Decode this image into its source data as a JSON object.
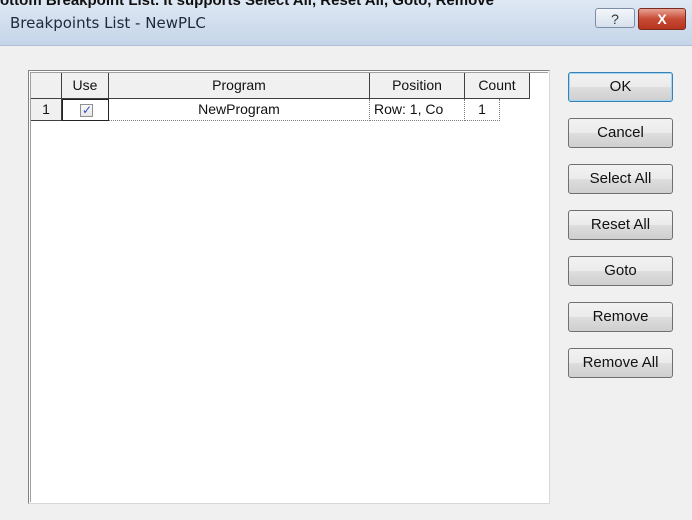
{
  "caption_overflow": "ottom Breakpoint List. It supports Select All, Reset All, Goto, Remove",
  "window": {
    "title": "Breakpoints List - NewPLC",
    "help_label": "?",
    "close_label": "X"
  },
  "table": {
    "columns": [
      "Use",
      "Program",
      "Position",
      "Count"
    ],
    "rows": [
      {
        "index": "1",
        "use": true,
        "program": "NewProgram",
        "position": "Row: 1, Co",
        "count": "1"
      }
    ]
  },
  "buttons": {
    "ok": "OK",
    "cancel": "Cancel",
    "select_all": "Select All",
    "reset_all": "Reset All",
    "goto": "Goto",
    "remove": "Remove",
    "remove_all": "Remove All"
  },
  "icons": {
    "check": "checkmark-icon",
    "help": "help-icon",
    "close": "close-icon"
  }
}
